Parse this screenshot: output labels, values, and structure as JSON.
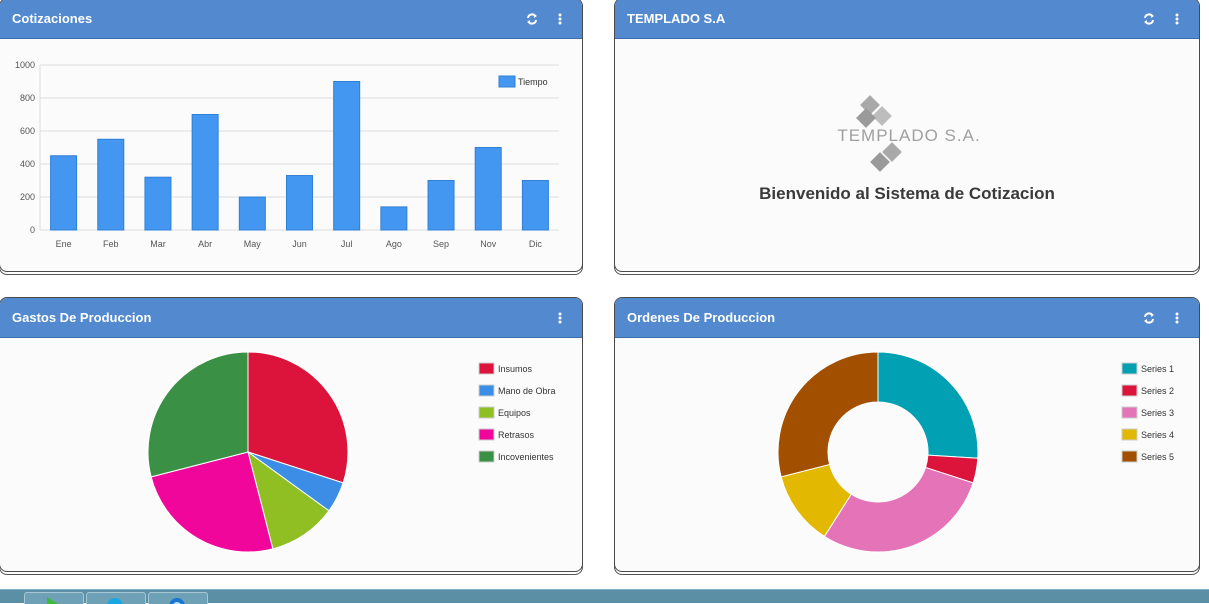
{
  "panels": {
    "cotizaciones": {
      "title": "Cotizaciones"
    },
    "templado": {
      "title": "TEMPLADO S.A",
      "logo_text": "TEMPLADO S.A.",
      "welcome": "Bienvenido al Sistema de Cotizacion"
    },
    "gastos": {
      "title": "Gastos De Produccion"
    },
    "ordenes": {
      "title": "Ordenes De Produccion"
    }
  },
  "icons": {
    "refresh": "refresh-icon",
    "menu": "vertical-ellipsis-icon"
  },
  "chart_data": [
    {
      "type": "bar",
      "categories": [
        "Ene",
        "Feb",
        "Mar",
        "Abr",
        "May",
        "Jun",
        "Jul",
        "Ago",
        "Sep",
        "Nov",
        "Dic"
      ],
      "series": [
        {
          "name": "Tiempo",
          "values": [
            450,
            550,
            320,
            700,
            200,
            330,
            900,
            140,
            300,
            500,
            300
          ],
          "color": "#4497f0"
        }
      ],
      "ylim": [
        0,
        1000
      ],
      "yticks": [
        "0",
        "200",
        "400",
        "600",
        "800",
        "1000"
      ],
      "grid": true,
      "legend": "top-right"
    },
    {
      "type": "pie",
      "labels": [
        "Insumos",
        "Mano de Obra",
        "Equipos",
        "Retrasos",
        "Incovenientes"
      ],
      "values": [
        30,
        5,
        11,
        25,
        29
      ],
      "colors": [
        "#dc143c",
        "#3c8de6",
        "#8fbf22",
        "#f0069a",
        "#3a9145"
      ],
      "legend": "right"
    },
    {
      "type": "pie",
      "donut": true,
      "labels": [
        "Series 1",
        "Series 2",
        "Series 3",
        "Series 4",
        "Series 5"
      ],
      "values": [
        26,
        4,
        29,
        12,
        29
      ],
      "colors": [
        "#01a0b2",
        "#dc143c",
        "#e573b7",
        "#e2b800",
        "#a24f00"
      ],
      "legend": "right"
    }
  ]
}
